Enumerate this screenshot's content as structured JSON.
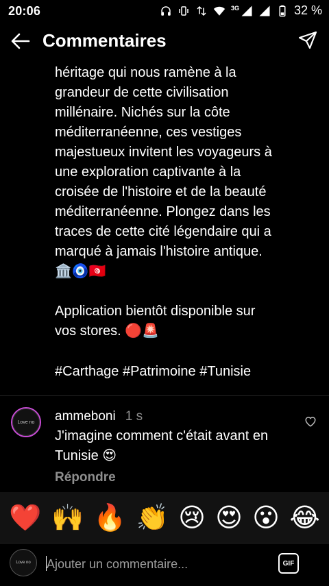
{
  "status_bar": {
    "time": "20:06",
    "battery": "32 %",
    "network": "3G",
    "icons": [
      "headphones-icon",
      "vibrate-icon",
      "data-arrows-icon",
      "wifi-icon",
      "signal-icon",
      "signal-icon",
      "battery-icon"
    ]
  },
  "header": {
    "title": "Commentaires",
    "back_icon": "arrow-left-icon",
    "share_icon": "paper-plane-icon"
  },
  "caption": {
    "text": "héritage qui nous ramène à la\ngrandeur de cette civilisation\nmillénaire. Nichés sur la côte\nméditerranéenne, ces vestiges\nmajestueux invitent les voyageurs à\nune exploration captivante à la\ncroisée de l'histoire et de la beauté\nméditerranéenne. Plongez dans les\ntraces de cette cité légendaire qui a\nmarqué à jamais l'histoire antique.\n🏛️🧿🇹🇳\n\nApplication bientôt disponible sur\nvos stores. 🔴🚨",
    "hashtags": "#Carthage #Patrimoine #Tunisie"
  },
  "comment": {
    "username": "ammeboni",
    "time": "1 s",
    "text": "J'imagine comment c'était avant en Tunisie 😍",
    "reply_label": "Répondre",
    "avatar_text": "Love no",
    "like_icon": "heart-outline-icon"
  },
  "emoji_bar": [
    "❤️",
    "🙌",
    "🔥",
    "👏",
    "😢",
    "😍",
    "😮",
    "😂"
  ],
  "input": {
    "placeholder": "Ajouter un commentaire...",
    "gif_label": "GIF",
    "avatar_text": "Love no"
  },
  "colors": {
    "background": "#000000",
    "muted_text": "#8e8e8e",
    "divider": "#262626",
    "avatar_ring": "#c84bd6"
  }
}
